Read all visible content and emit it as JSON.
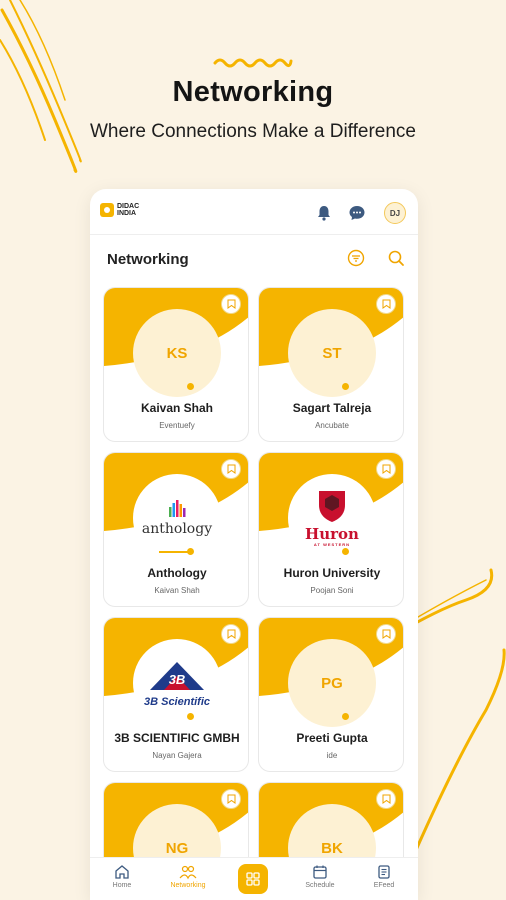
{
  "hero": {
    "title": "Networking",
    "subtitle": "Where Connections Make a Difference"
  },
  "colors": {
    "accent": "#f5b400",
    "background": "#fbf3e4",
    "avatar_bg": "#fdf1d3"
  },
  "app": {
    "logo_line1": "DIDAC",
    "logo_line2": "INDIA",
    "user_initials": "DJ",
    "header_icons": [
      "bell-icon",
      "chat-icon"
    ]
  },
  "section": {
    "title": "Networking",
    "icons": [
      "filter-icon",
      "search-icon"
    ]
  },
  "cards": [
    {
      "initials": "KS",
      "name": "Kaivan Shah",
      "subtitle": "Eventuefy",
      "type": "initials"
    },
    {
      "initials": "ST",
      "name": "Sagart Talreja",
      "subtitle": "Ancubate",
      "type": "initials"
    },
    {
      "initials": "",
      "name": "Anthology",
      "subtitle": "Kaivan Shah",
      "type": "logo",
      "logo_text": "anthology"
    },
    {
      "initials": "",
      "name": "Huron University",
      "subtitle": "Poojan Soni",
      "type": "logo",
      "logo_text": "Huron",
      "logo_subtext": "AT WESTERN"
    },
    {
      "initials": "",
      "name": "3B SCIENTIFIC GMBH",
      "subtitle": "Nayan Gajera",
      "type": "logo",
      "logo_text": "3B Scientific",
      "logo_mark": "3B"
    },
    {
      "initials": "PG",
      "name": "Preeti Gupta",
      "subtitle": "ide",
      "type": "initials"
    },
    {
      "initials": "NG",
      "name": "",
      "subtitle": "",
      "type": "initials"
    },
    {
      "initials": "BK",
      "name": "",
      "subtitle": "",
      "type": "initials"
    }
  ],
  "nav": [
    {
      "label": "Home",
      "icon": "home-icon"
    },
    {
      "label": "Networking",
      "icon": "networking-icon",
      "active": true
    },
    {
      "label": "",
      "icon": "grid-icon"
    },
    {
      "label": "Schedule",
      "icon": "calendar-icon"
    },
    {
      "label": "EFeed",
      "icon": "feed-icon"
    }
  ]
}
